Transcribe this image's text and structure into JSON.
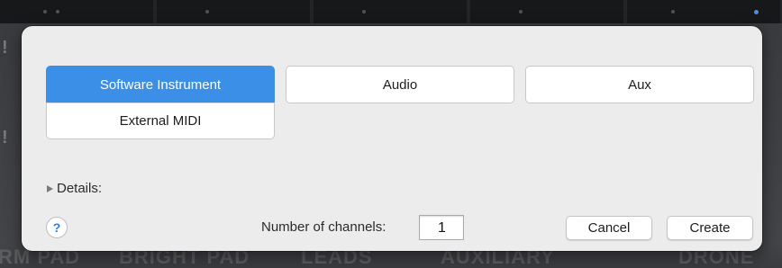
{
  "dialog": {
    "track_types": [
      {
        "label": "Software Instrument",
        "selected": true
      },
      {
        "label": "External MIDI",
        "selected": false
      },
      {
        "label": "Audio",
        "selected": false
      },
      {
        "label": "Aux",
        "selected": false
      }
    ],
    "details_label": "Details:",
    "help_label": "?",
    "channels_label": "Number of channels:",
    "channels_value": "1",
    "cancel_label": "Cancel",
    "create_label": "Create"
  },
  "background": {
    "pad_labels": [
      "RM PAD",
      "BRIGHT PAD",
      "LEADS",
      "AUXILIARY",
      "DRONE"
    ]
  },
  "colors": {
    "selected": "#3c8fe6",
    "dialog_bg": "#ececec",
    "help_glyph": "#2f7de1"
  },
  "icons": {
    "disclosure": "disclosure-triangle-right-icon",
    "help": "help-icon"
  }
}
